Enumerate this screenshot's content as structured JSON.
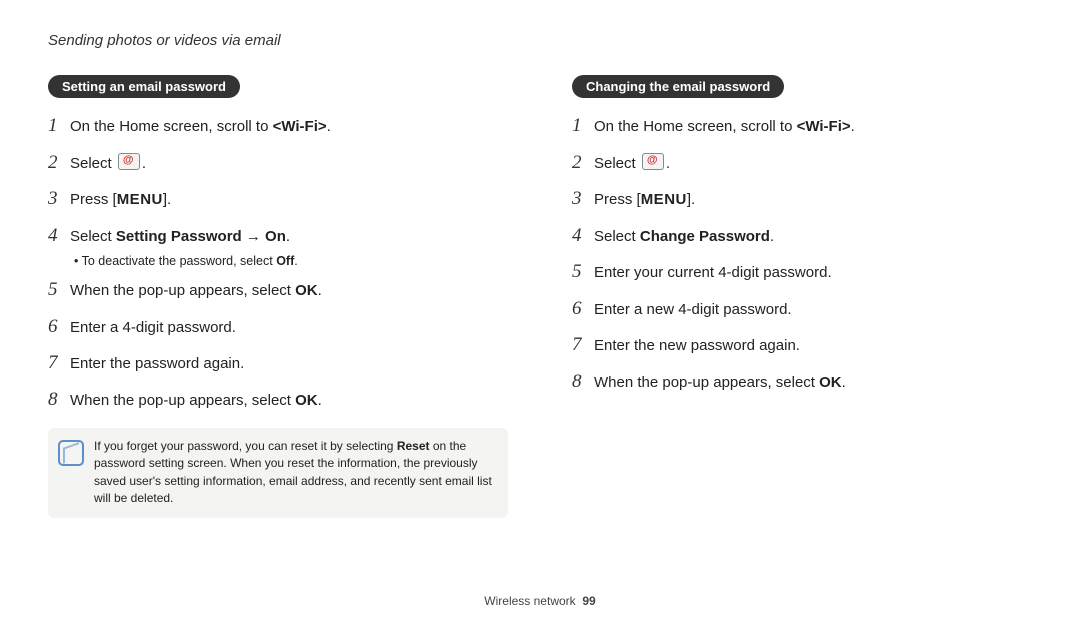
{
  "header": "Sending photos or videos via email",
  "footer": {
    "section": "Wireless network",
    "page": "99"
  },
  "left": {
    "title": "Setting an email password",
    "steps": [
      {
        "n": "1",
        "pre": "On the Home screen, scroll to ",
        "wifi": "<Wi-Fi>",
        "post": "."
      },
      {
        "n": "2",
        "pre": "Select ",
        "mailicon": true,
        "post": "."
      },
      {
        "n": "3",
        "pre": "Press [",
        "menu": "MENU",
        "post": "]."
      },
      {
        "n": "4",
        "pre": "Select ",
        "bold": "Setting Password → On",
        "post": ".",
        "bullet_pre": "To deactivate the password, select ",
        "bullet_bold": "Off",
        "bullet_post": "."
      },
      {
        "n": "5",
        "pre": "When the pop-up appears, select ",
        "bold": "OK",
        "post": "."
      },
      {
        "n": "6",
        "pre": "Enter a 4-digit password."
      },
      {
        "n": "7",
        "pre": "Enter the password again."
      },
      {
        "n": "8",
        "pre": "When the pop-up appears, select ",
        "bold": "OK",
        "post": "."
      }
    ],
    "note_pre": "If you forget your password, you can reset it by selecting ",
    "note_bold": "Reset",
    "note_post": " on the password setting screen. When you reset the information, the previously saved user's setting information, email address, and recently sent email list will be deleted."
  },
  "right": {
    "title": "Changing the email password",
    "steps": [
      {
        "n": "1",
        "pre": "On the Home screen, scroll to ",
        "wifi": "<Wi-Fi>",
        "post": "."
      },
      {
        "n": "2",
        "pre": "Select ",
        "mailicon": true,
        "post": "."
      },
      {
        "n": "3",
        "pre": "Press [",
        "menu": "MENU",
        "post": "]."
      },
      {
        "n": "4",
        "pre": "Select ",
        "bold": "Change Password",
        "post": "."
      },
      {
        "n": "5",
        "pre": "Enter your current 4-digit password."
      },
      {
        "n": "6",
        "pre": "Enter a new 4-digit password."
      },
      {
        "n": "7",
        "pre": "Enter the new password again."
      },
      {
        "n": "8",
        "pre": "When the pop-up appears, select ",
        "bold": "OK",
        "post": "."
      }
    ]
  }
}
